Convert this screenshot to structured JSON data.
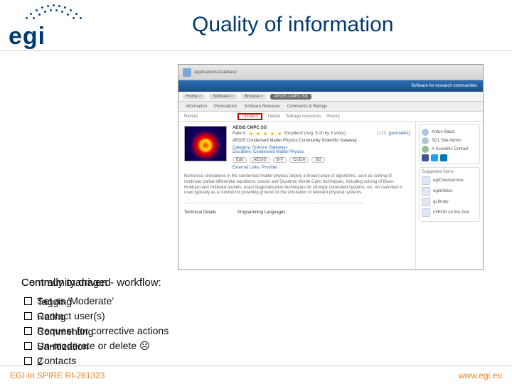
{
  "title": "Quality of information",
  "logo_text": "egi",
  "screenshot": {
    "app_title": "Applications Database",
    "blue_banner": "Software for research communities",
    "crumbs": [
      "Home >",
      "Software >",
      "Browse >",
      "AEGIS CMPC SG"
    ],
    "tabs": [
      "Information",
      "Publications",
      "Software Releases",
      "Comments & Ratings"
    ],
    "subtabs_left": "Reload",
    "subtabs_highlight": "Updated",
    "subtabs_rest": [
      "Delete",
      "Storage resources",
      "History"
    ],
    "item_title": "AEGIS CMPC SG",
    "rate_label": "Rate it:",
    "rate_score": "Excellent! (Avg. 5.00 by 3 votes)",
    "rate_count": "1173",
    "permalink": "[permalink]",
    "item_sub": "AEGIS Condensed Matter Physics Community Scientific Gateway",
    "category_label": "Category: Science Gateways",
    "discipline_label": "Discipline: Condensed Matter Physics",
    "tags": [
      "Edit",
      "AEGIS",
      "B-F",
      "CUDA",
      "SG"
    ],
    "ext_label": "External Links: Provider",
    "para1": "Numerical simulations in the condensed matter physics deploy a broad range of algorithms, such as solving of nonlinear partial differential equations, classic and Quantum Monte Carlo techniques, including solving of Bose-Hubbard and Hubbard models, exact diagonalization techniques for strongly correlated systems, etc. An overview is used typically as a conduit for providing ground for the simulation of relevant physical systems.",
    "para2": "………………………………………………………………………………………………………………",
    "side": {
      "contact_name": "Antun Balaz",
      "contact_role": "SCL Site Admin",
      "add_contact": "A Scientific Contact",
      "suggested": "Suggested Items",
      "items": [
        "egiCloudservice",
        "egiInSilico",
        "gLibrary",
        "mIROP on the Grid"
      ]
    },
    "bottom_labels": {
      "tech": "Technical Details",
      "lang": "Programming Languages:"
    }
  },
  "body": {
    "heading_layers": [
      "Centrally managed",
      "Community driven - workflow:"
    ],
    "bullets": [
      [
        "Set as 'Moderate'",
        "Tagging"
      ],
      [
        "Contact user(s)",
        "Rating"
      ],
      [
        "Request for corrective actions",
        "Commenting"
      ],
      [
        "Un-moderate or delete ☹",
        "Sanitization"
      ],
      [
        "Contacts",
        "2"
      ]
    ]
  },
  "footer": {
    "left": "EGI-In.SPIRE RI-261323",
    "right": "www.egi.eu"
  }
}
